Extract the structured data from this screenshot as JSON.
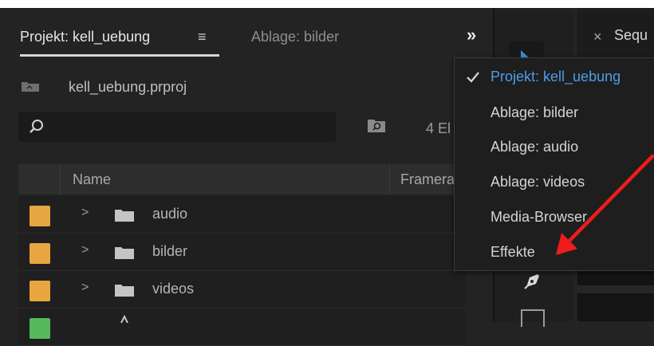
{
  "tabs": {
    "project_tab": "Projekt: kell_uebung",
    "menu_icon": "≡",
    "ablage_tab": "Ablage: bilder",
    "overflow": "»"
  },
  "project": {
    "filename": "kell_uebung.prproj",
    "search_placeholder": "",
    "item_count": "4 El"
  },
  "table": {
    "col_name": "Name",
    "col_framerate": "Framera",
    "rows": [
      {
        "label": "audio",
        "color": "#e8a640"
      },
      {
        "label": "bilder",
        "color": "#e8a640"
      },
      {
        "label": "videos",
        "color": "#e8a640"
      },
      {
        "label": "",
        "color": "#55b85a"
      }
    ]
  },
  "sequence": {
    "close": "×",
    "label": "Sequ"
  },
  "menu": {
    "items": [
      {
        "label": "Projekt: kell_uebung",
        "checked": true
      },
      {
        "label": "Ablage: bilder",
        "checked": false
      },
      {
        "label": "Ablage: audio",
        "checked": false
      },
      {
        "label": "Ablage: videos",
        "checked": false
      },
      {
        "label": "Media-Browser",
        "checked": false
      },
      {
        "label": "Effekte",
        "checked": false
      }
    ]
  },
  "colors": {
    "accent": "#4d9de8",
    "folder_label": "#e8a640",
    "annotation_arrow": "#ee1c1c"
  }
}
